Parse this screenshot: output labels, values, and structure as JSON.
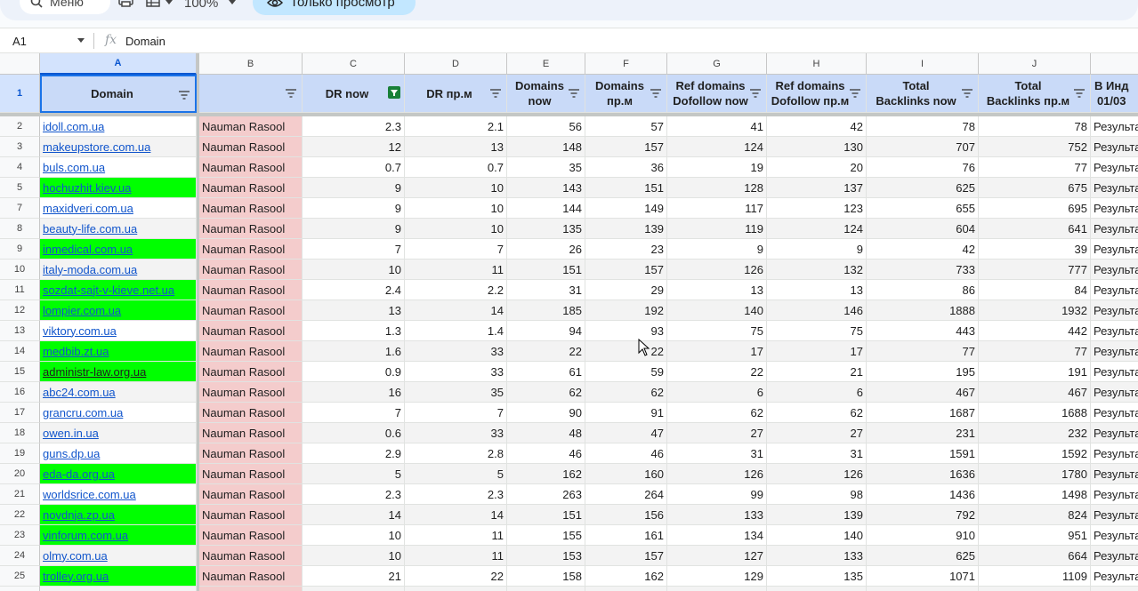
{
  "toolbar": {
    "search_label": "Меню",
    "zoom": "100%",
    "view_only_label": "Только просмотр"
  },
  "formula_bar": {
    "cell_ref": "A1",
    "fx": "fx",
    "content": "Domain"
  },
  "columns": [
    "A",
    "B",
    "C",
    "D",
    "E",
    "F",
    "G",
    "H",
    "I",
    "J",
    ""
  ],
  "headers": {
    "a": "Domain",
    "b": "",
    "c": "DR now",
    "d": "DR пр.м",
    "e1": "Domains",
    "e2": "now",
    "f1": "Domains",
    "f2": "пр.м",
    "g1": "Ref domains",
    "g2": "Dofollow now",
    "h1": "Ref domains",
    "h2": "Dofollow пр.м",
    "i1": "Total",
    "i2": "Backlinks now",
    "j1": "Total",
    "j2": "Backlinks пр.м",
    "k1": "В Инд",
    "k2": "01/03"
  },
  "rows": [
    {
      "n": "2",
      "domain": "idoll.com.ua",
      "b": "Nauman Rasool",
      "c": "2.3",
      "d": "2.1",
      "e": "56",
      "f": "57",
      "g": "41",
      "h": "42",
      "i": "78",
      "j": "78",
      "k": "Результа",
      "green": false
    },
    {
      "n": "3",
      "domain": "makeupstore.com.ua",
      "b": "Nauman Rasool",
      "c": "12",
      "d": "13",
      "e": "148",
      "f": "157",
      "g": "124",
      "h": "130",
      "i": "707",
      "j": "752",
      "k": "Результа",
      "green": false
    },
    {
      "n": "4",
      "domain": "buls.com.ua",
      "b": "Nauman Rasool",
      "c": "0.7",
      "d": "0.7",
      "e": "35",
      "f": "36",
      "g": "19",
      "h": "20",
      "i": "76",
      "j": "77",
      "k": "Результа",
      "green": false
    },
    {
      "n": "5",
      "domain": "hochuzhit.kiev.ua",
      "b": "Nauman Rasool",
      "c": "9",
      "d": "10",
      "e": "143",
      "f": "151",
      "g": "128",
      "h": "137",
      "i": "625",
      "j": "675",
      "k": "Результа",
      "green": true
    },
    {
      "n": "7",
      "domain": "maxidveri.com.ua",
      "b": "Nauman Rasool",
      "c": "9",
      "d": "10",
      "e": "144",
      "f": "149",
      "g": "117",
      "h": "123",
      "i": "655",
      "j": "695",
      "k": "Результа",
      "green": false
    },
    {
      "n": "8",
      "domain": "beauty-life.com.ua",
      "b": "Nauman Rasool",
      "c": "9",
      "d": "10",
      "e": "135",
      "f": "139",
      "g": "119",
      "h": "124",
      "i": "604",
      "j": "641",
      "k": "Результа",
      "green": false
    },
    {
      "n": "9",
      "domain": "inmedical.com.ua",
      "b": "Nauman Rasool",
      "c": "7",
      "d": "7",
      "e": "26",
      "f": "23",
      "g": "9",
      "h": "9",
      "i": "42",
      "j": "39",
      "k": "Результа",
      "green": true
    },
    {
      "n": "10",
      "domain": "italy-moda.com.ua",
      "b": "Nauman Rasool",
      "c": "10",
      "d": "11",
      "e": "151",
      "f": "157",
      "g": "126",
      "h": "132",
      "i": "733",
      "j": "777",
      "k": "Результа",
      "green": false
    },
    {
      "n": "11",
      "domain": "sozdat-sajt-v-kieve.net.ua",
      "b": "Nauman Rasool",
      "c": "2.4",
      "d": "2.2",
      "e": "31",
      "f": "29",
      "g": "13",
      "h": "13",
      "i": "86",
      "j": "84",
      "k": "Результа",
      "green": true
    },
    {
      "n": "12",
      "domain": "lompier.com.ua",
      "b": "Nauman Rasool",
      "c": "13",
      "d": "14",
      "e": "185",
      "f": "192",
      "g": "140",
      "h": "146",
      "i": "1888",
      "j": "1932",
      "k": "Результа",
      "green": true
    },
    {
      "n": "13",
      "domain": "viktory.com.ua",
      "b": "Nauman Rasool",
      "c": "1.3",
      "d": "1.4",
      "e": "94",
      "f": "93",
      "g": "75",
      "h": "75",
      "i": "443",
      "j": "442",
      "k": "Результа",
      "green": false
    },
    {
      "n": "14",
      "domain": "medbib.zt.ua",
      "b": "Nauman Rasool",
      "c": "1.6",
      "d": "33",
      "e": "22",
      "f": "22",
      "g": "17",
      "h": "17",
      "i": "77",
      "j": "77",
      "k": "Результа",
      "green": true
    },
    {
      "n": "15",
      "domain": "administr-law.org.ua",
      "b": "Nauman Rasool",
      "c": "0.9",
      "d": "33",
      "e": "61",
      "f": "59",
      "g": "22",
      "h": "21",
      "i": "195",
      "j": "191",
      "k": "Результа",
      "green": true,
      "dark": true
    },
    {
      "n": "16",
      "domain": "abc24.com.ua",
      "b": "Nauman Rasool",
      "c": "16",
      "d": "35",
      "e": "62",
      "f": "62",
      "g": "6",
      "h": "6",
      "i": "467",
      "j": "467",
      "k": "Результа",
      "green": false
    },
    {
      "n": "17",
      "domain": "grancru.com.ua",
      "b": "Nauman Rasool",
      "c": "7",
      "d": "7",
      "e": "90",
      "f": "91",
      "g": "62",
      "h": "62",
      "i": "1687",
      "j": "1688",
      "k": "Результа",
      "green": false
    },
    {
      "n": "18",
      "domain": "owen.in.ua",
      "b": "Nauman Rasool",
      "c": "0.6",
      "d": "33",
      "e": "48",
      "f": "47",
      "g": "27",
      "h": "27",
      "i": "231",
      "j": "232",
      "k": "Результа",
      "green": false
    },
    {
      "n": "19",
      "domain": "guns.dp.ua",
      "b": "Nauman Rasool",
      "c": "2.9",
      "d": "2.8",
      "e": "46",
      "f": "46",
      "g": "31",
      "h": "31",
      "i": "1591",
      "j": "1592",
      "k": "Результа",
      "green": false
    },
    {
      "n": "20",
      "domain": "eda-da.org.ua",
      "b": "Nauman Rasool",
      "c": "5",
      "d": "5",
      "e": "162",
      "f": "160",
      "g": "126",
      "h": "126",
      "i": "1636",
      "j": "1780",
      "k": "Результа",
      "green": true
    },
    {
      "n": "21",
      "domain": "worldsrice.com.ua",
      "b": "Nauman Rasool",
      "c": "2.3",
      "d": "2.3",
      "e": "263",
      "f": "264",
      "g": "99",
      "h": "98",
      "i": "1436",
      "j": "1498",
      "k": "Результа",
      "green": false
    },
    {
      "n": "22",
      "domain": "novdnja.zp.ua",
      "b": "Nauman Rasool",
      "c": "14",
      "d": "14",
      "e": "151",
      "f": "156",
      "g": "133",
      "h": "139",
      "i": "792",
      "j": "824",
      "k": "Результа",
      "green": true
    },
    {
      "n": "23",
      "domain": "vinforum.com.ua",
      "b": "Nauman Rasool",
      "c": "10",
      "d": "11",
      "e": "155",
      "f": "161",
      "g": "134",
      "h": "140",
      "i": "910",
      "j": "951",
      "k": "Результа",
      "green": true
    },
    {
      "n": "24",
      "domain": "olmy.com.ua",
      "b": "Nauman Rasool",
      "c": "10",
      "d": "11",
      "e": "153",
      "f": "157",
      "g": "127",
      "h": "133",
      "i": "625",
      "j": "664",
      "k": "Результа",
      "green": false
    },
    {
      "n": "25",
      "domain": "trolley.org.ua",
      "b": "Nauman Rasool",
      "c": "21",
      "d": "22",
      "e": "158",
      "f": "162",
      "g": "129",
      "h": "135",
      "i": "1071",
      "j": "1109",
      "k": "Результа",
      "green": true
    }
  ]
}
